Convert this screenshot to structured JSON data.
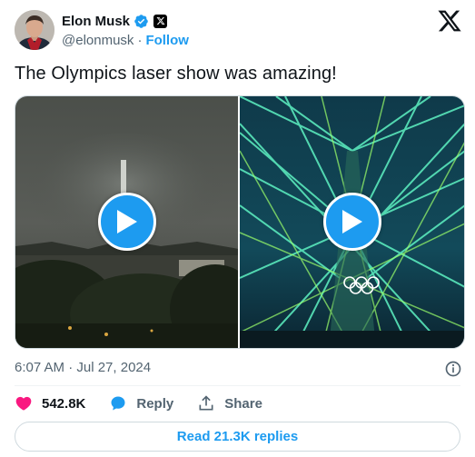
{
  "author": {
    "name": "Elon Musk",
    "handle": "@elonmusk",
    "separator": "·",
    "follow_label": "Follow"
  },
  "tweet": {
    "text": "The Olympics laser show was amazing!",
    "timestamp": "6:07 AM · Jul 27, 2024"
  },
  "media": {
    "videos": [
      {
        "scene": "night-city-tower",
        "icon": "play-icon"
      },
      {
        "scene": "green-laser-show",
        "icon": "play-icon"
      }
    ]
  },
  "actions": {
    "likes": "542.8K",
    "reply_label": "Reply",
    "share_label": "Share"
  },
  "read_replies_label": "Read 21.3K replies",
  "colors": {
    "accent": "#1d9bf0",
    "like": "#f91880",
    "text": "#0f1419",
    "secondary": "#536471"
  }
}
